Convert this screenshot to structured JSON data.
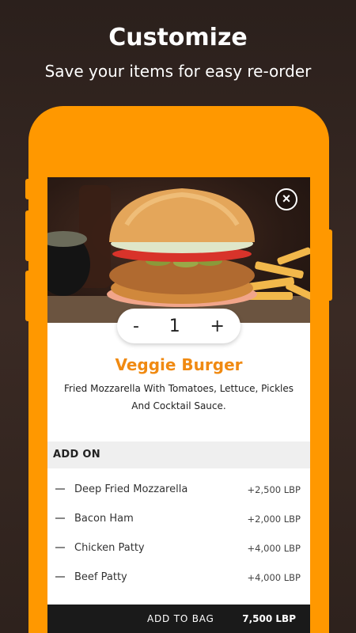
{
  "promo": {
    "headline": "Customize",
    "subline": "Save your items for easy re-order"
  },
  "item": {
    "name": "Veggie Burger",
    "description": "Fried Mozzarella With Tomatoes, Lettuce, Pickles And Cocktail Sauce.",
    "image": "burger-with-fries-photo"
  },
  "quantity": {
    "minus": "-",
    "value": "1",
    "plus": "+"
  },
  "close_icon": "close-circle-icon",
  "addons": {
    "header": "ADD ON",
    "items": [
      {
        "name": "Deep Fried Mozzarella",
        "price": "+2,500 LBP"
      },
      {
        "name": "Bacon Ham",
        "price": "+2,000 LBP"
      },
      {
        "name": "Chicken Patty",
        "price": "+4,000 LBP"
      },
      {
        "name": "Beef Patty",
        "price": "+4,000 LBP"
      }
    ]
  },
  "bag": {
    "label": "ADD TO BAG",
    "total": "7,500 LBP"
  },
  "colors": {
    "accent": "#ff9800",
    "title": "#f08a12",
    "bag_bar": "#1a1a1a"
  }
}
